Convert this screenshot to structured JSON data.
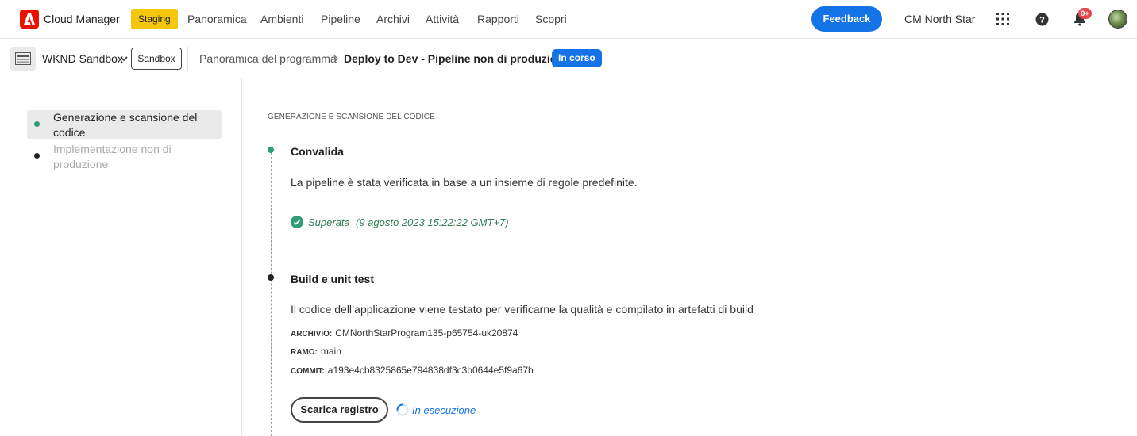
{
  "header": {
    "app_name": "Cloud Manager",
    "environment": "Staging",
    "nav": [
      "Panoramica",
      "Ambienti",
      "Pipeline",
      "Archivi",
      "Attività",
      "Rapporti",
      "Scopri"
    ],
    "feedback_label": "Feedback",
    "org_name": "CM North Star",
    "notification_count": "9+",
    "icons": [
      "adobe-logo-icon",
      "apps-grid-icon",
      "help-icon",
      "bell-icon"
    ],
    "colors": {
      "accent": "#1473e6",
      "env_badge": "#f4c70d",
      "logo": "#eb1000",
      "notif": "#e34850"
    }
  },
  "subheader": {
    "program_name": "WKND Sandbox",
    "program_type": "Sandbox",
    "breadcrumb": "Panoramica del programma",
    "pipeline_title": "Deploy to Dev - Pipeline non di produzione",
    "status": "In corso"
  },
  "steps": [
    {
      "label": "Generazione e scansione del codice",
      "state": "active",
      "color": "#2d9d78"
    },
    {
      "label": "Implementazione non di produzione",
      "state": "inactive",
      "color": "#222222"
    }
  ],
  "main": {
    "section_title": "GENERAZIONE E SCANSIONE DEL CODICE",
    "stages": [
      {
        "title": "Convalida",
        "description": "La pipeline è stata verificata in base a un insieme di regole predefinite.",
        "result_label": "Superata",
        "result_time": "(9 agosto 2023 15:22:22 GMT+7)"
      },
      {
        "title": "Build e unit test",
        "description": "Il codice dell’applicazione viene testato per verificarne la qualità e compilato in artefatti di build",
        "meta": [
          {
            "key": "ARCHIVIO:",
            "value": "CMNorthStarProgram135-p65754-uk20874"
          },
          {
            "key": "RAMO:",
            "value": "main"
          },
          {
            "key": "COMMIT:",
            "value": "a193e4cb8325865e794838df3c3b0644e5f9a67b"
          }
        ],
        "download_label": "Scarica registro",
        "running_label": "In esecuzione"
      }
    ]
  }
}
